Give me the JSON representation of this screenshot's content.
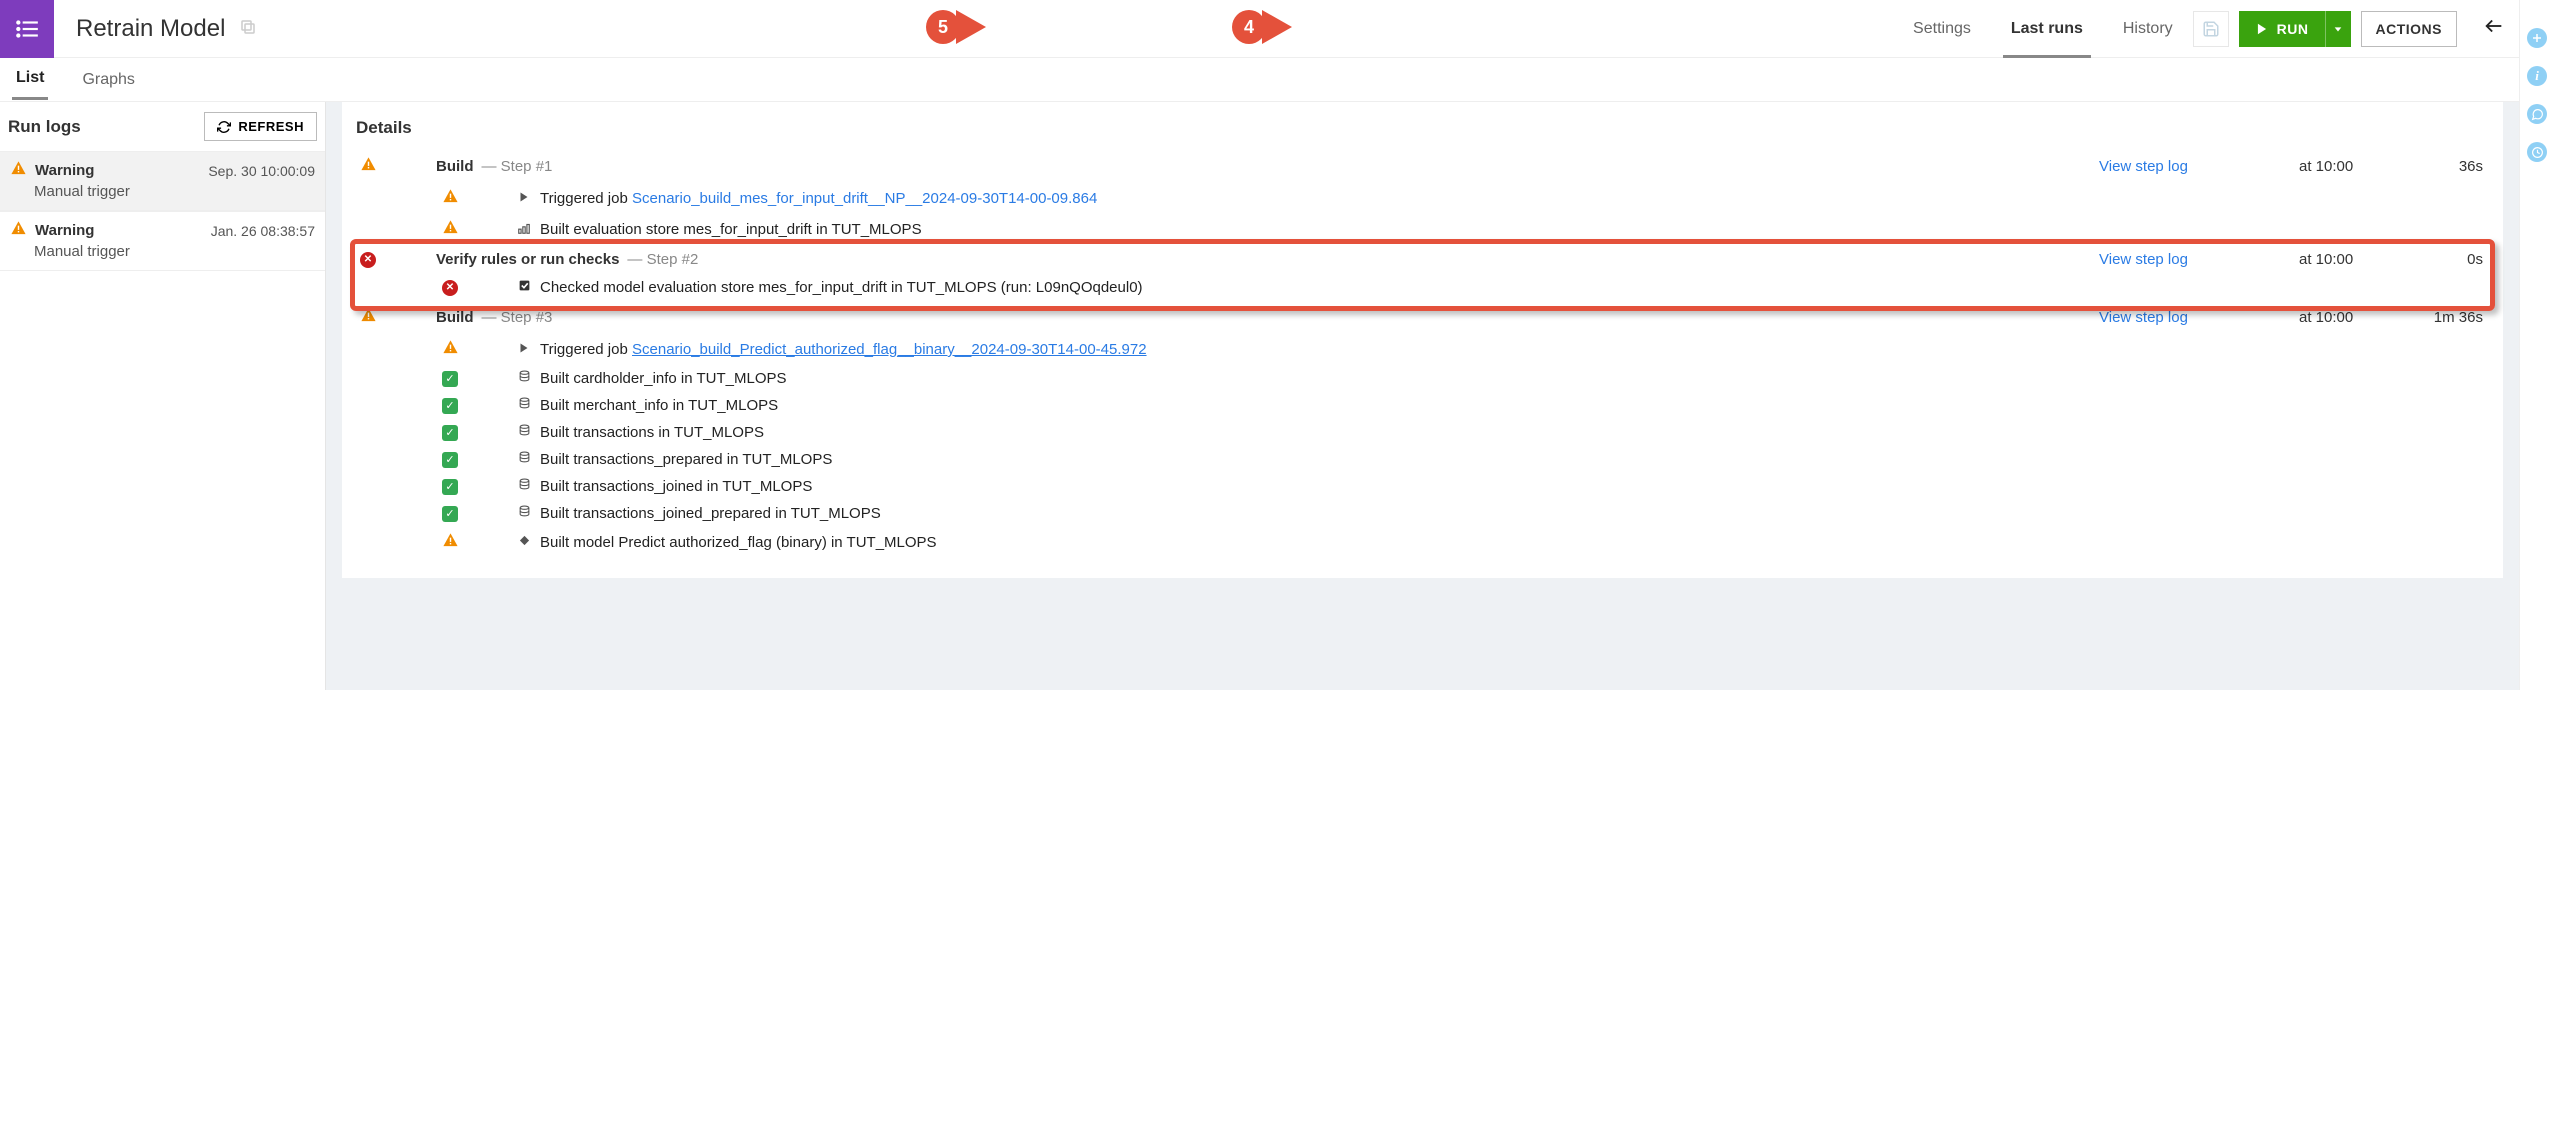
{
  "header": {
    "title": "Retrain Model",
    "tabs": [
      "Settings",
      "Last runs",
      "History"
    ],
    "active_tab": "Last runs",
    "run_label": "RUN",
    "actions_label": "ACTIONS"
  },
  "callouts": {
    "c4": "4",
    "c5": "5"
  },
  "subtabs": {
    "items": [
      "List",
      "Graphs"
    ],
    "active": "List"
  },
  "sidebar": {
    "title": "Run logs",
    "refresh_label": "REFRESH",
    "items": [
      {
        "status": "warn",
        "title": "Warning",
        "date": "Sep. 30 10:00:09",
        "sub": "Manual trigger",
        "selected": true
      },
      {
        "status": "warn",
        "title": "Warning",
        "date": "Jan. 26 08:38:57",
        "sub": "Manual trigger",
        "selected": false
      }
    ]
  },
  "details": {
    "heading": "Details",
    "steps": [
      {
        "status": "warn",
        "name": "Build",
        "suffix": " — Step #1",
        "log_link": "View step log",
        "time": "at 10:00",
        "duration": "36s",
        "rows": [
          {
            "status": "warn",
            "icon": "play",
            "prefix": "Triggered job ",
            "link": "Scenario_build_mes_for_input_drift__NP__2024-09-30T14-00-09.864",
            "link_style": "plain"
          },
          {
            "status": "warn",
            "icon": "group",
            "text": "Built evaluation store mes_for_input_drift in TUT_MLOPS"
          }
        ]
      },
      {
        "status": "err",
        "name": "Verify rules or run checks",
        "suffix": " — Step #2",
        "log_link": "View step log",
        "time": "at 10:00",
        "duration": "0s",
        "highlight": true,
        "rows": [
          {
            "status": "err",
            "icon": "check",
            "text": "Checked model evaluation store mes_for_input_drift in TUT_MLOPS (run: L09nQOqdeul0)"
          }
        ]
      },
      {
        "status": "warn",
        "name": "Build",
        "suffix": " — Step #3",
        "log_link": "View step log",
        "time": "at 10:00",
        "duration": "1m 36s",
        "rows": [
          {
            "status": "warn",
            "icon": "play",
            "prefix": "Triggered job ",
            "link": "Scenario_build_Predict_authorized_flag__binary__2024-09-30T14-00-45.972",
            "link_style": "underline"
          },
          {
            "status": "ok",
            "icon": "db",
            "text": "Built cardholder_info in TUT_MLOPS"
          },
          {
            "status": "ok",
            "icon": "db",
            "text": "Built merchant_info in TUT_MLOPS"
          },
          {
            "status": "ok",
            "icon": "db",
            "text": "Built transactions in TUT_MLOPS"
          },
          {
            "status": "ok",
            "icon": "db",
            "text": "Built transactions_prepared in TUT_MLOPS"
          },
          {
            "status": "ok",
            "icon": "db",
            "text": "Built transactions_joined in TUT_MLOPS"
          },
          {
            "status": "ok",
            "icon": "db",
            "text": "Built transactions_joined_prepared in TUT_MLOPS"
          },
          {
            "status": "warn",
            "icon": "diamond",
            "text": "Built model Predict authorized_flag (binary) in TUT_MLOPS"
          }
        ]
      }
    ]
  }
}
